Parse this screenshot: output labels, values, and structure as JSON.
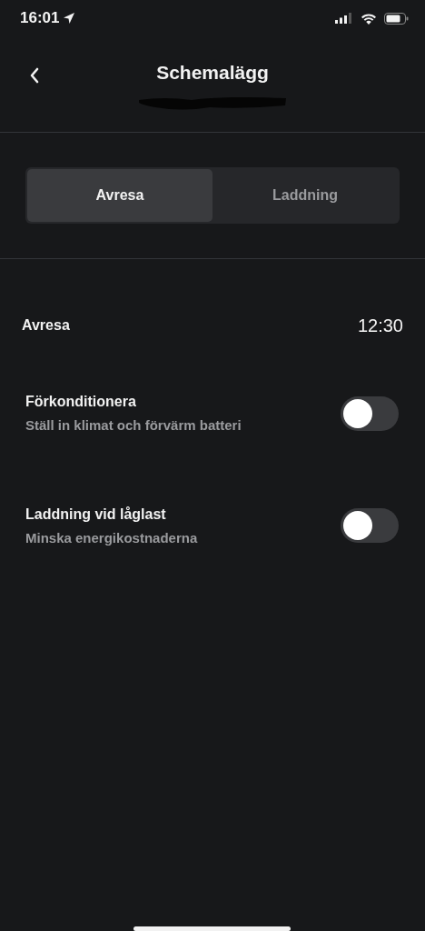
{
  "status_bar": {
    "time": "16:01"
  },
  "header": {
    "title": "Schemalägg"
  },
  "segments": [
    {
      "label": "Avresa",
      "selected": true
    },
    {
      "label": "Laddning",
      "selected": false
    }
  ],
  "departure": {
    "label": "Avresa",
    "value": "12:30"
  },
  "settings": [
    {
      "title": "Förkonditionera",
      "subtitle": "Ställ in klimat och förvärm batteri",
      "on": false
    },
    {
      "title": "Laddning vid låglast",
      "subtitle": "Minska energikostnaderna",
      "on": false
    }
  ]
}
